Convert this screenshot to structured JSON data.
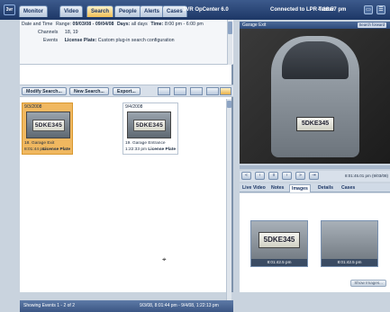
{
  "topbar": {
    "logo": "3vr",
    "tabs": [
      {
        "label": "Monitor"
      },
      {
        "label": "Video"
      },
      {
        "label": "Search"
      },
      {
        "label": "People"
      },
      {
        "label": "Alerts"
      },
      {
        "label": "Cases"
      }
    ],
    "active_tab": "Search",
    "app_name": "3VR OpCenter 6.0",
    "connection": "Connected to LPR Tester",
    "clock": "4:16:57 pm"
  },
  "criteria": {
    "date_label": "Date and Time",
    "range_label": "Range:",
    "range_value": "09/03/08 - 09/04/08",
    "days_label": "Days:",
    "days_value": "all days",
    "time_label": "Time:",
    "time_value": "8:00 pm - 6:00 pm",
    "channels_label": "Channels",
    "channels_value": "18, 19",
    "events_label": "Events",
    "events_type": "License Plate:",
    "events_value": "Custom plug-in search configuration"
  },
  "toolbar": {
    "modify": "Modify Search...",
    "new": "New Search...",
    "export": "Export..."
  },
  "results": [
    {
      "date": "9/3/2008",
      "plate": "5DKE345",
      "label": "18. Garage Exit",
      "time": "8:01:44 pm",
      "type": "License Plate",
      "selected": true
    },
    {
      "date": "9/4/2008",
      "plate": "5DKE345",
      "label": "19. Garage Entrance",
      "time": "1:22:33 pm",
      "type": "License Plate",
      "selected": false
    }
  ],
  "status": {
    "count": "Showing Events 1 - 2 of 2",
    "range": "9/3/08, 8:01:44 pm - 9/4/08, 1:22:13 pm"
  },
  "viewer": {
    "camera": "Garage Exit",
    "forward": "Search forward",
    "plate": "5DKE345",
    "timestamp": "8:01:45.01 pm (9/03/08)"
  },
  "info_tabs": [
    {
      "label": "Live Video"
    },
    {
      "label": "Notes"
    },
    {
      "label": "Images"
    },
    {
      "label": "Details"
    },
    {
      "label": "Cases"
    }
  ],
  "active_info_tab": "Images",
  "images": [
    {
      "plate": "5DKE345",
      "caption": "8:01:42.5 pm"
    },
    {
      "plate": "",
      "caption": "8:01:42.5 pm"
    }
  ],
  "show_images": "Show Images..."
}
